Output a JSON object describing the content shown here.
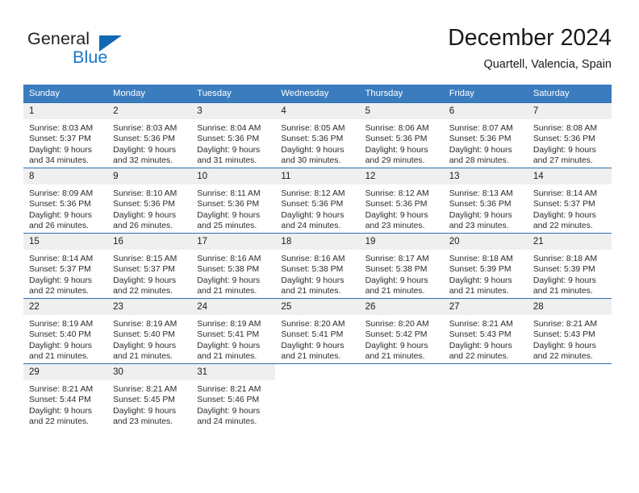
{
  "brand": {
    "name_top": "General",
    "name_bottom": "Blue",
    "accent_color": "#1877c9",
    "triangle_color": "#1268b3"
  },
  "header": {
    "title": "December 2024",
    "subtitle": "Quartell, Valencia, Spain"
  },
  "theme": {
    "header_row_bg": "#3b7cbe",
    "row_divider": "#2f6fb0",
    "daynum_bg": "#efefef",
    "text": "#2b2b2b"
  },
  "calendar": {
    "weekday_headers": [
      "Sunday",
      "Monday",
      "Tuesday",
      "Wednesday",
      "Thursday",
      "Friday",
      "Saturday"
    ],
    "weeks": [
      [
        {
          "day": "1",
          "sunrise": "Sunrise: 8:03 AM",
          "sunset": "Sunset: 5:37 PM",
          "daylight_1": "Daylight: 9 hours",
          "daylight_2": "and 34 minutes."
        },
        {
          "day": "2",
          "sunrise": "Sunrise: 8:03 AM",
          "sunset": "Sunset: 5:36 PM",
          "daylight_1": "Daylight: 9 hours",
          "daylight_2": "and 32 minutes."
        },
        {
          "day": "3",
          "sunrise": "Sunrise: 8:04 AM",
          "sunset": "Sunset: 5:36 PM",
          "daylight_1": "Daylight: 9 hours",
          "daylight_2": "and 31 minutes."
        },
        {
          "day": "4",
          "sunrise": "Sunrise: 8:05 AM",
          "sunset": "Sunset: 5:36 PM",
          "daylight_1": "Daylight: 9 hours",
          "daylight_2": "and 30 minutes."
        },
        {
          "day": "5",
          "sunrise": "Sunrise: 8:06 AM",
          "sunset": "Sunset: 5:36 PM",
          "daylight_1": "Daylight: 9 hours",
          "daylight_2": "and 29 minutes."
        },
        {
          "day": "6",
          "sunrise": "Sunrise: 8:07 AM",
          "sunset": "Sunset: 5:36 PM",
          "daylight_1": "Daylight: 9 hours",
          "daylight_2": "and 28 minutes."
        },
        {
          "day": "7",
          "sunrise": "Sunrise: 8:08 AM",
          "sunset": "Sunset: 5:36 PM",
          "daylight_1": "Daylight: 9 hours",
          "daylight_2": "and 27 minutes."
        }
      ],
      [
        {
          "day": "8",
          "sunrise": "Sunrise: 8:09 AM",
          "sunset": "Sunset: 5:36 PM",
          "daylight_1": "Daylight: 9 hours",
          "daylight_2": "and 26 minutes."
        },
        {
          "day": "9",
          "sunrise": "Sunrise: 8:10 AM",
          "sunset": "Sunset: 5:36 PM",
          "daylight_1": "Daylight: 9 hours",
          "daylight_2": "and 26 minutes."
        },
        {
          "day": "10",
          "sunrise": "Sunrise: 8:11 AM",
          "sunset": "Sunset: 5:36 PM",
          "daylight_1": "Daylight: 9 hours",
          "daylight_2": "and 25 minutes."
        },
        {
          "day": "11",
          "sunrise": "Sunrise: 8:12 AM",
          "sunset": "Sunset: 5:36 PM",
          "daylight_1": "Daylight: 9 hours",
          "daylight_2": "and 24 minutes."
        },
        {
          "day": "12",
          "sunrise": "Sunrise: 8:12 AM",
          "sunset": "Sunset: 5:36 PM",
          "daylight_1": "Daylight: 9 hours",
          "daylight_2": "and 23 minutes."
        },
        {
          "day": "13",
          "sunrise": "Sunrise: 8:13 AM",
          "sunset": "Sunset: 5:36 PM",
          "daylight_1": "Daylight: 9 hours",
          "daylight_2": "and 23 minutes."
        },
        {
          "day": "14",
          "sunrise": "Sunrise: 8:14 AM",
          "sunset": "Sunset: 5:37 PM",
          "daylight_1": "Daylight: 9 hours",
          "daylight_2": "and 22 minutes."
        }
      ],
      [
        {
          "day": "15",
          "sunrise": "Sunrise: 8:14 AM",
          "sunset": "Sunset: 5:37 PM",
          "daylight_1": "Daylight: 9 hours",
          "daylight_2": "and 22 minutes."
        },
        {
          "day": "16",
          "sunrise": "Sunrise: 8:15 AM",
          "sunset": "Sunset: 5:37 PM",
          "daylight_1": "Daylight: 9 hours",
          "daylight_2": "and 22 minutes."
        },
        {
          "day": "17",
          "sunrise": "Sunrise: 8:16 AM",
          "sunset": "Sunset: 5:38 PM",
          "daylight_1": "Daylight: 9 hours",
          "daylight_2": "and 21 minutes."
        },
        {
          "day": "18",
          "sunrise": "Sunrise: 8:16 AM",
          "sunset": "Sunset: 5:38 PM",
          "daylight_1": "Daylight: 9 hours",
          "daylight_2": "and 21 minutes."
        },
        {
          "day": "19",
          "sunrise": "Sunrise: 8:17 AM",
          "sunset": "Sunset: 5:38 PM",
          "daylight_1": "Daylight: 9 hours",
          "daylight_2": "and 21 minutes."
        },
        {
          "day": "20",
          "sunrise": "Sunrise: 8:18 AM",
          "sunset": "Sunset: 5:39 PM",
          "daylight_1": "Daylight: 9 hours",
          "daylight_2": "and 21 minutes."
        },
        {
          "day": "21",
          "sunrise": "Sunrise: 8:18 AM",
          "sunset": "Sunset: 5:39 PM",
          "daylight_1": "Daylight: 9 hours",
          "daylight_2": "and 21 minutes."
        }
      ],
      [
        {
          "day": "22",
          "sunrise": "Sunrise: 8:19 AM",
          "sunset": "Sunset: 5:40 PM",
          "daylight_1": "Daylight: 9 hours",
          "daylight_2": "and 21 minutes."
        },
        {
          "day": "23",
          "sunrise": "Sunrise: 8:19 AM",
          "sunset": "Sunset: 5:40 PM",
          "daylight_1": "Daylight: 9 hours",
          "daylight_2": "and 21 minutes."
        },
        {
          "day": "24",
          "sunrise": "Sunrise: 8:19 AM",
          "sunset": "Sunset: 5:41 PM",
          "daylight_1": "Daylight: 9 hours",
          "daylight_2": "and 21 minutes."
        },
        {
          "day": "25",
          "sunrise": "Sunrise: 8:20 AM",
          "sunset": "Sunset: 5:41 PM",
          "daylight_1": "Daylight: 9 hours",
          "daylight_2": "and 21 minutes."
        },
        {
          "day": "26",
          "sunrise": "Sunrise: 8:20 AM",
          "sunset": "Sunset: 5:42 PM",
          "daylight_1": "Daylight: 9 hours",
          "daylight_2": "and 21 minutes."
        },
        {
          "day": "27",
          "sunrise": "Sunrise: 8:21 AM",
          "sunset": "Sunset: 5:43 PM",
          "daylight_1": "Daylight: 9 hours",
          "daylight_2": "and 22 minutes."
        },
        {
          "day": "28",
          "sunrise": "Sunrise: 8:21 AM",
          "sunset": "Sunset: 5:43 PM",
          "daylight_1": "Daylight: 9 hours",
          "daylight_2": "and 22 minutes."
        }
      ],
      [
        {
          "day": "29",
          "sunrise": "Sunrise: 8:21 AM",
          "sunset": "Sunset: 5:44 PM",
          "daylight_1": "Daylight: 9 hours",
          "daylight_2": "and 22 minutes."
        },
        {
          "day": "30",
          "sunrise": "Sunrise: 8:21 AM",
          "sunset": "Sunset: 5:45 PM",
          "daylight_1": "Daylight: 9 hours",
          "daylight_2": "and 23 minutes."
        },
        {
          "day": "31",
          "sunrise": "Sunrise: 8:21 AM",
          "sunset": "Sunset: 5:46 PM",
          "daylight_1": "Daylight: 9 hours",
          "daylight_2": "and 24 minutes."
        },
        {
          "day": "",
          "sunrise": "",
          "sunset": "",
          "daylight_1": "",
          "daylight_2": ""
        },
        {
          "day": "",
          "sunrise": "",
          "sunset": "",
          "daylight_1": "",
          "daylight_2": ""
        },
        {
          "day": "",
          "sunrise": "",
          "sunset": "",
          "daylight_1": "",
          "daylight_2": ""
        },
        {
          "day": "",
          "sunrise": "",
          "sunset": "",
          "daylight_1": "",
          "daylight_2": ""
        }
      ]
    ]
  }
}
